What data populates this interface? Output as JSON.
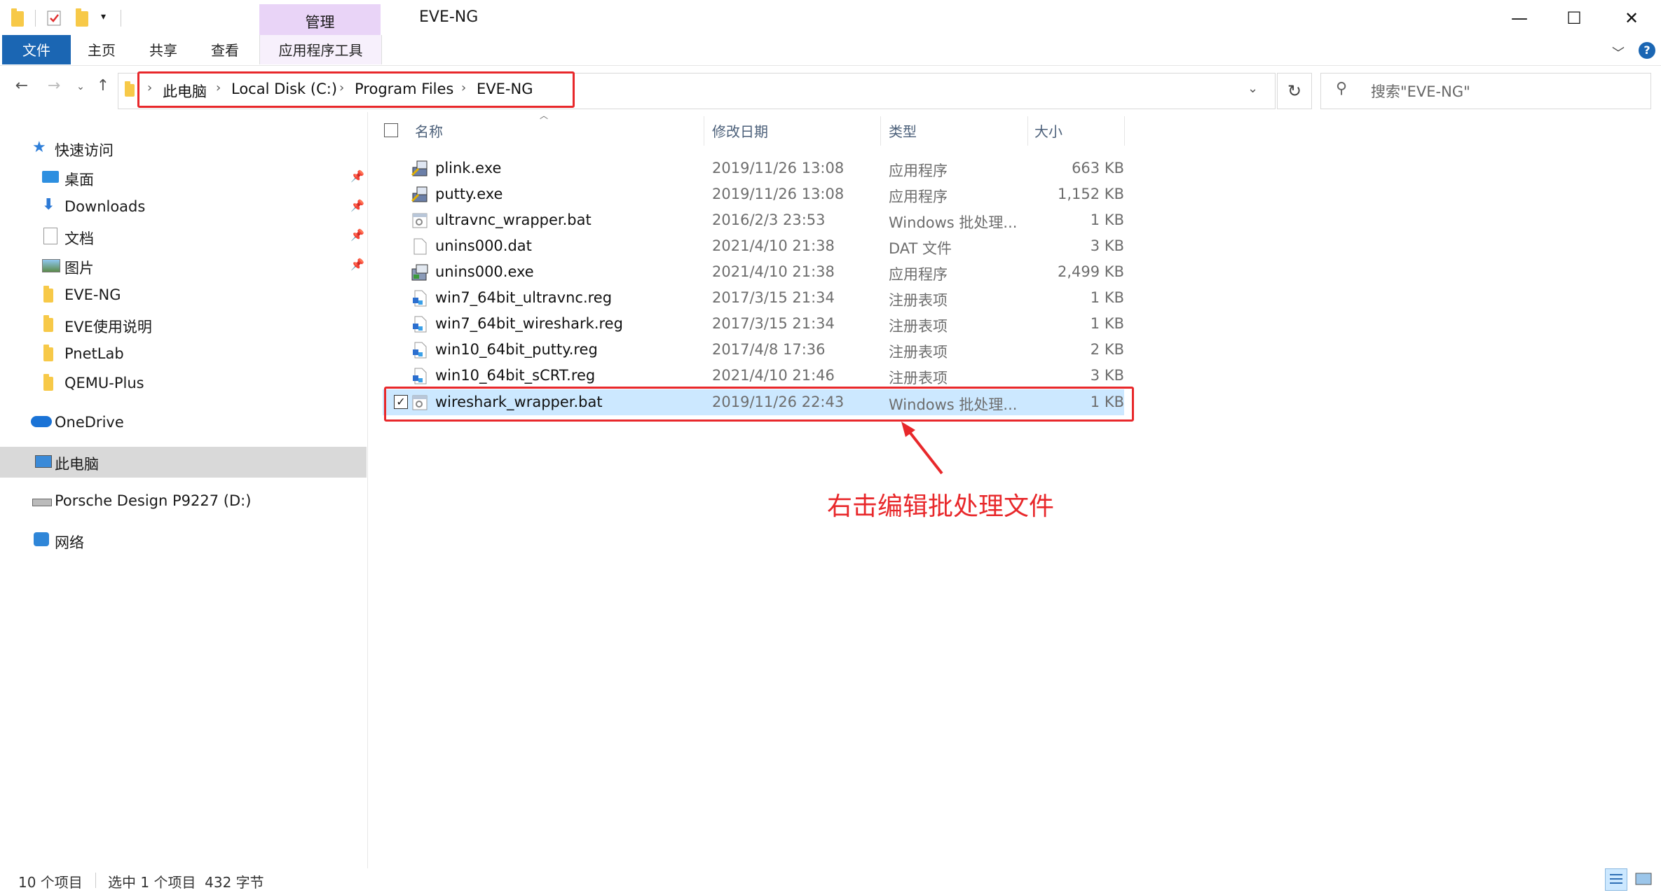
{
  "window": {
    "title": "EVE-NG",
    "context_tab_group": "管理",
    "minimize": "—",
    "maximize": "☐",
    "close": "✕"
  },
  "ribbon": {
    "tabs": [
      "文件",
      "主页",
      "共享",
      "查看",
      "应用程序工具"
    ],
    "help_icon": "?"
  },
  "address": {
    "breadcrumbs": [
      "此电脑",
      "Local Disk (C:)",
      "Program Files",
      "EVE-NG"
    ],
    "search_placeholder": "搜索\"EVE-NG\""
  },
  "sidebar": {
    "items": [
      {
        "label": "快速访问",
        "icon": "star-icon",
        "pinned": false
      },
      {
        "label": "桌面",
        "icon": "desktop-icon",
        "pinned": true
      },
      {
        "label": "Downloads",
        "icon": "download-arrow-icon",
        "pinned": true
      },
      {
        "label": "文档",
        "icon": "document-icon",
        "pinned": true
      },
      {
        "label": "图片",
        "icon": "picture-icon",
        "pinned": true
      },
      {
        "label": "EVE-NG",
        "icon": "folder-icon",
        "pinned": false
      },
      {
        "label": "EVE使用说明",
        "icon": "folder-icon",
        "pinned": false
      },
      {
        "label": "PnetLab",
        "icon": "folder-icon",
        "pinned": false
      },
      {
        "label": "QEMU-Plus",
        "icon": "folder-icon",
        "pinned": false
      },
      {
        "label": "OneDrive",
        "icon": "cloud-icon",
        "pinned": false
      },
      {
        "label": "此电脑",
        "icon": "computer-icon",
        "pinned": false,
        "selected": true
      },
      {
        "label": "Porsche Design P9227 (D:)",
        "icon": "drive-icon",
        "pinned": false
      },
      {
        "label": "网络",
        "icon": "network-icon",
        "pinned": false
      }
    ]
  },
  "columns": {
    "name": "名称",
    "date": "修改日期",
    "type": "类型",
    "size": "大小"
  },
  "files": [
    {
      "name": "plink.exe",
      "date": "2019/11/26 13:08",
      "type": "应用程序",
      "size": "663 KB",
      "icon": "putty-exe-icon"
    },
    {
      "name": "putty.exe",
      "date": "2019/11/26 13:08",
      "type": "应用程序",
      "size": "1,152 KB",
      "icon": "putty-exe-icon"
    },
    {
      "name": "ultravnc_wrapper.bat",
      "date": "2016/2/3 23:53",
      "type": "Windows 批处理...",
      "size": "1 KB",
      "icon": "bat-file-icon"
    },
    {
      "name": "unins000.dat",
      "date": "2021/4/10 21:38",
      "type": "DAT 文件",
      "size": "3 KB",
      "icon": "blank-file-icon"
    },
    {
      "name": "unins000.exe",
      "date": "2021/4/10 21:38",
      "type": "应用程序",
      "size": "2,499 KB",
      "icon": "installer-exe-icon"
    },
    {
      "name": "win7_64bit_ultravnc.reg",
      "date": "2017/3/15 21:34",
      "type": "注册表项",
      "size": "1 KB",
      "icon": "registry-file-icon"
    },
    {
      "name": "win7_64bit_wireshark.reg",
      "date": "2017/3/15 21:34",
      "type": "注册表项",
      "size": "1 KB",
      "icon": "registry-file-icon"
    },
    {
      "name": "win10_64bit_putty.reg",
      "date": "2017/4/8 17:36",
      "type": "注册表项",
      "size": "2 KB",
      "icon": "registry-file-icon"
    },
    {
      "name": "win10_64bit_sCRT.reg",
      "date": "2021/4/10 21:46",
      "type": "注册表项",
      "size": "3 KB",
      "icon": "registry-file-icon"
    },
    {
      "name": "wireshark_wrapper.bat",
      "date": "2019/11/26 22:43",
      "type": "Windows 批处理...",
      "size": "1 KB",
      "icon": "bat-file-icon",
      "selected": true
    }
  ],
  "annotation": {
    "text": "右击编辑批处理文件",
    "color": "#e8282b"
  },
  "status": {
    "count": "10 个项目",
    "selection": "选中 1 个项目  432 字节"
  },
  "colors": {
    "file_tab": "#1b66b3",
    "context_tab": "#e9d4f7",
    "selection": "#cce8ff",
    "highlight_frame": "#e8282b"
  }
}
